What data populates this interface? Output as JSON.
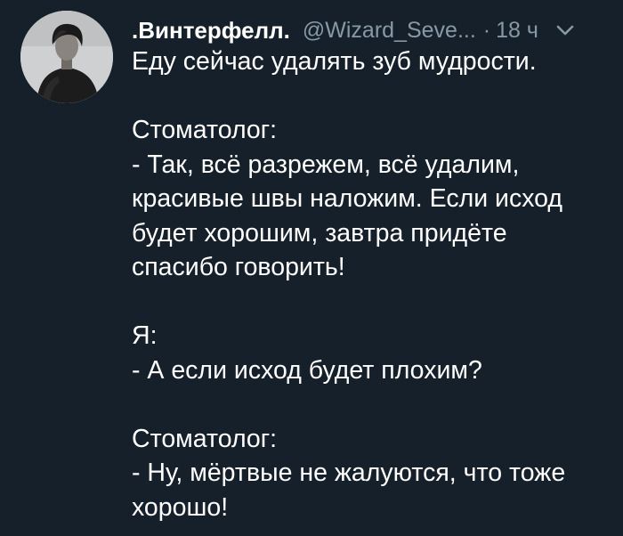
{
  "tweet": {
    "display_name": ".Винтерфелл.",
    "handle": "@Wizard_Seve...",
    "separator": "·",
    "time": "18 ч",
    "lines": [
      "Еду сейчас удалять зуб мудрости.",
      "",
      "Стоматолог:",
      "- Так, всё разрежем, всё удалим,",
      "красивые швы наложим. Если исход",
      "будет хорошим, завтра придёте",
      "спасибо говорить!",
      "",
      "Я:",
      "- А если исход будет плохим?",
      "",
      "Стоматолог:",
      "- Ну, мёртвые не жалуются, что тоже",
      "хорошо!"
    ]
  },
  "icons": {
    "avatar": "user-avatar-photo",
    "menu": "chevron-down-icon"
  },
  "colors": {
    "background": "#15202b",
    "primary_text": "#ffffff",
    "secondary_text": "#8899a6"
  }
}
